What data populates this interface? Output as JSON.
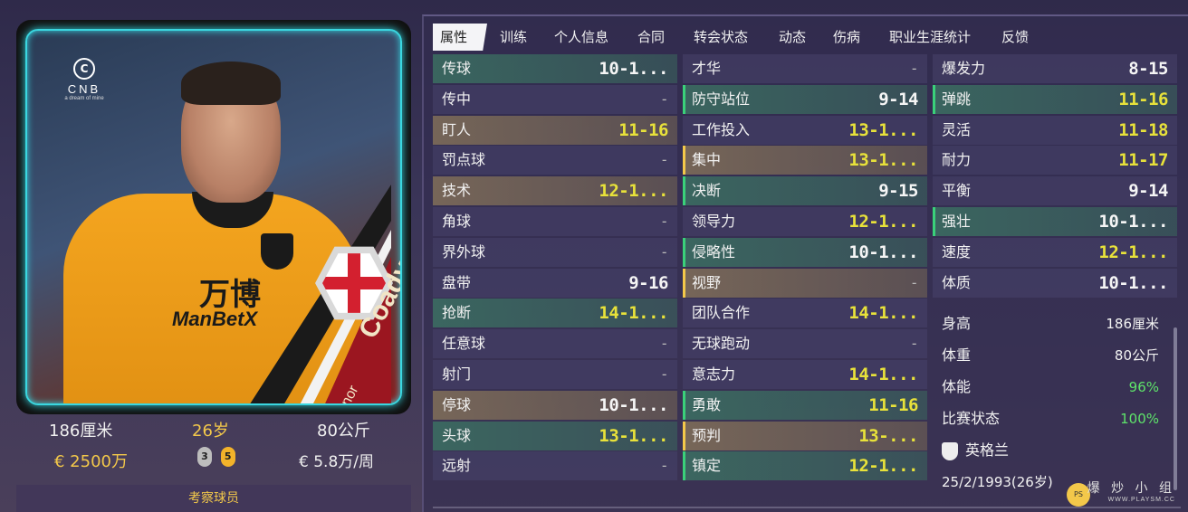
{
  "card": {
    "brand_name": "CNB",
    "brand_tagline": "a dream of mine",
    "sponsor_cn": "万博",
    "sponsor_en": "ManBetX",
    "surname": "Coady",
    "firstname": "Conor"
  },
  "player": {
    "height": "186厘米",
    "age": "26岁",
    "weight": "80公斤",
    "value": "€ 2500万",
    "wage": "€ 5.8万/周",
    "foot_left": "3",
    "foot_right": "5",
    "scout_label": "考察球员"
  },
  "tabs": [
    "属性",
    "训练",
    "个人信息",
    "合同",
    "转会状态",
    "动态",
    "伤病",
    "职业生涯统计",
    "反馈"
  ],
  "col1": [
    {
      "name": "传球",
      "val": "10-1...",
      "bg": "green",
      "color": "white"
    },
    {
      "name": "传中",
      "val": "-",
      "bg": "plain",
      "color": "dash"
    },
    {
      "name": "盯人",
      "val": "11-16",
      "bg": "tan",
      "color": "yellow"
    },
    {
      "name": "罚点球",
      "val": "-",
      "bg": "plain",
      "color": "dash"
    },
    {
      "name": "技术",
      "val": "12-1...",
      "bg": "tan",
      "color": "yellow"
    },
    {
      "name": "角球",
      "val": "-",
      "bg": "plain",
      "color": "dash"
    },
    {
      "name": "界外球",
      "val": "-",
      "bg": "plain",
      "color": "dash"
    },
    {
      "name": "盘带",
      "val": "9-16",
      "bg": "plain",
      "color": "white"
    },
    {
      "name": "抢断",
      "val": "14-1...",
      "bg": "green",
      "color": "yellow"
    },
    {
      "name": "任意球",
      "val": "-",
      "bg": "plain",
      "color": "dash"
    },
    {
      "name": "射门",
      "val": "-",
      "bg": "plain",
      "color": "dash"
    },
    {
      "name": "停球",
      "val": "10-1...",
      "bg": "tan",
      "color": "white"
    },
    {
      "name": "头球",
      "val": "13-1...",
      "bg": "green",
      "color": "yellow"
    },
    {
      "name": "远射",
      "val": "-",
      "bg": "plain",
      "color": "dash"
    }
  ],
  "col2": [
    {
      "name": "才华",
      "val": "-",
      "bg": "plain",
      "color": "dash",
      "marker": ""
    },
    {
      "name": "防守站位",
      "val": "9-14",
      "bg": "green",
      "color": "white",
      "marker": "#3ad17a"
    },
    {
      "name": "工作投入",
      "val": "13-1...",
      "bg": "plain",
      "color": "yellow",
      "marker": ""
    },
    {
      "name": "集中",
      "val": "13-1...",
      "bg": "tan",
      "color": "yellow",
      "marker": "#f3c84a"
    },
    {
      "name": "决断",
      "val": "9-15",
      "bg": "green",
      "color": "white",
      "marker": "#3ad17a"
    },
    {
      "name": "领导力",
      "val": "12-1...",
      "bg": "plain",
      "color": "yellow",
      "marker": ""
    },
    {
      "name": "侵略性",
      "val": "10-1...",
      "bg": "green",
      "color": "white",
      "marker": "#3ad17a"
    },
    {
      "name": "视野",
      "val": "-",
      "bg": "tan",
      "color": "dash",
      "marker": "#f3c84a"
    },
    {
      "name": "团队合作",
      "val": "14-1...",
      "bg": "plain",
      "color": "yellow",
      "marker": ""
    },
    {
      "name": "无球跑动",
      "val": "-",
      "bg": "plain",
      "color": "dash",
      "marker": ""
    },
    {
      "name": "意志力",
      "val": "14-1...",
      "bg": "plain",
      "color": "yellow",
      "marker": ""
    },
    {
      "name": "勇敢",
      "val": "11-16",
      "bg": "green",
      "color": "yellow",
      "marker": "#3ad17a"
    },
    {
      "name": "预判",
      "val": "13-...",
      "bg": "tan",
      "color": "yellow",
      "marker": "#f3c84a"
    },
    {
      "name": "镇定",
      "val": "12-1...",
      "bg": "green",
      "color": "yellow",
      "marker": "#3ad17a"
    }
  ],
  "col3": [
    {
      "name": "爆发力",
      "val": "8-15",
      "bg": "plain",
      "color": "white",
      "marker": ""
    },
    {
      "name": "弹跳",
      "val": "11-16",
      "bg": "green",
      "color": "yellow",
      "marker": "#3ad17a"
    },
    {
      "name": "灵活",
      "val": "11-18",
      "bg": "plain",
      "color": "yellow",
      "marker": ""
    },
    {
      "name": "耐力",
      "val": "11-17",
      "bg": "plain",
      "color": "yellow",
      "marker": ""
    },
    {
      "name": "平衡",
      "val": "9-14",
      "bg": "plain",
      "color": "white",
      "marker": ""
    },
    {
      "name": "强壮",
      "val": "10-1...",
      "bg": "green",
      "color": "white",
      "marker": "#3ad17a"
    },
    {
      "name": "速度",
      "val": "12-1...",
      "bg": "plain",
      "color": "yellow",
      "marker": ""
    },
    {
      "name": "体质",
      "val": "10-1...",
      "bg": "plain",
      "color": "white",
      "marker": ""
    }
  ],
  "stats": {
    "height_label": "身高",
    "height_value": "186厘米",
    "weight_label": "体重",
    "weight_value": "80公斤",
    "fitness_label": "体能",
    "fitness_value": "96%",
    "form_label": "比赛状态",
    "form_value": "100%",
    "nation": "英格兰",
    "dob": "25/2/1993(26岁)"
  },
  "watermark": {
    "cn": "爆 炒 小 组",
    "en": "WWW.PLAYSM.CC",
    "logo": "PS"
  },
  "colors": {
    "accent_cyan": "#3ad7e0",
    "green_marker": "#3ad17a",
    "gold": "#f3c84a",
    "yellow_value": "#e8e23a"
  }
}
